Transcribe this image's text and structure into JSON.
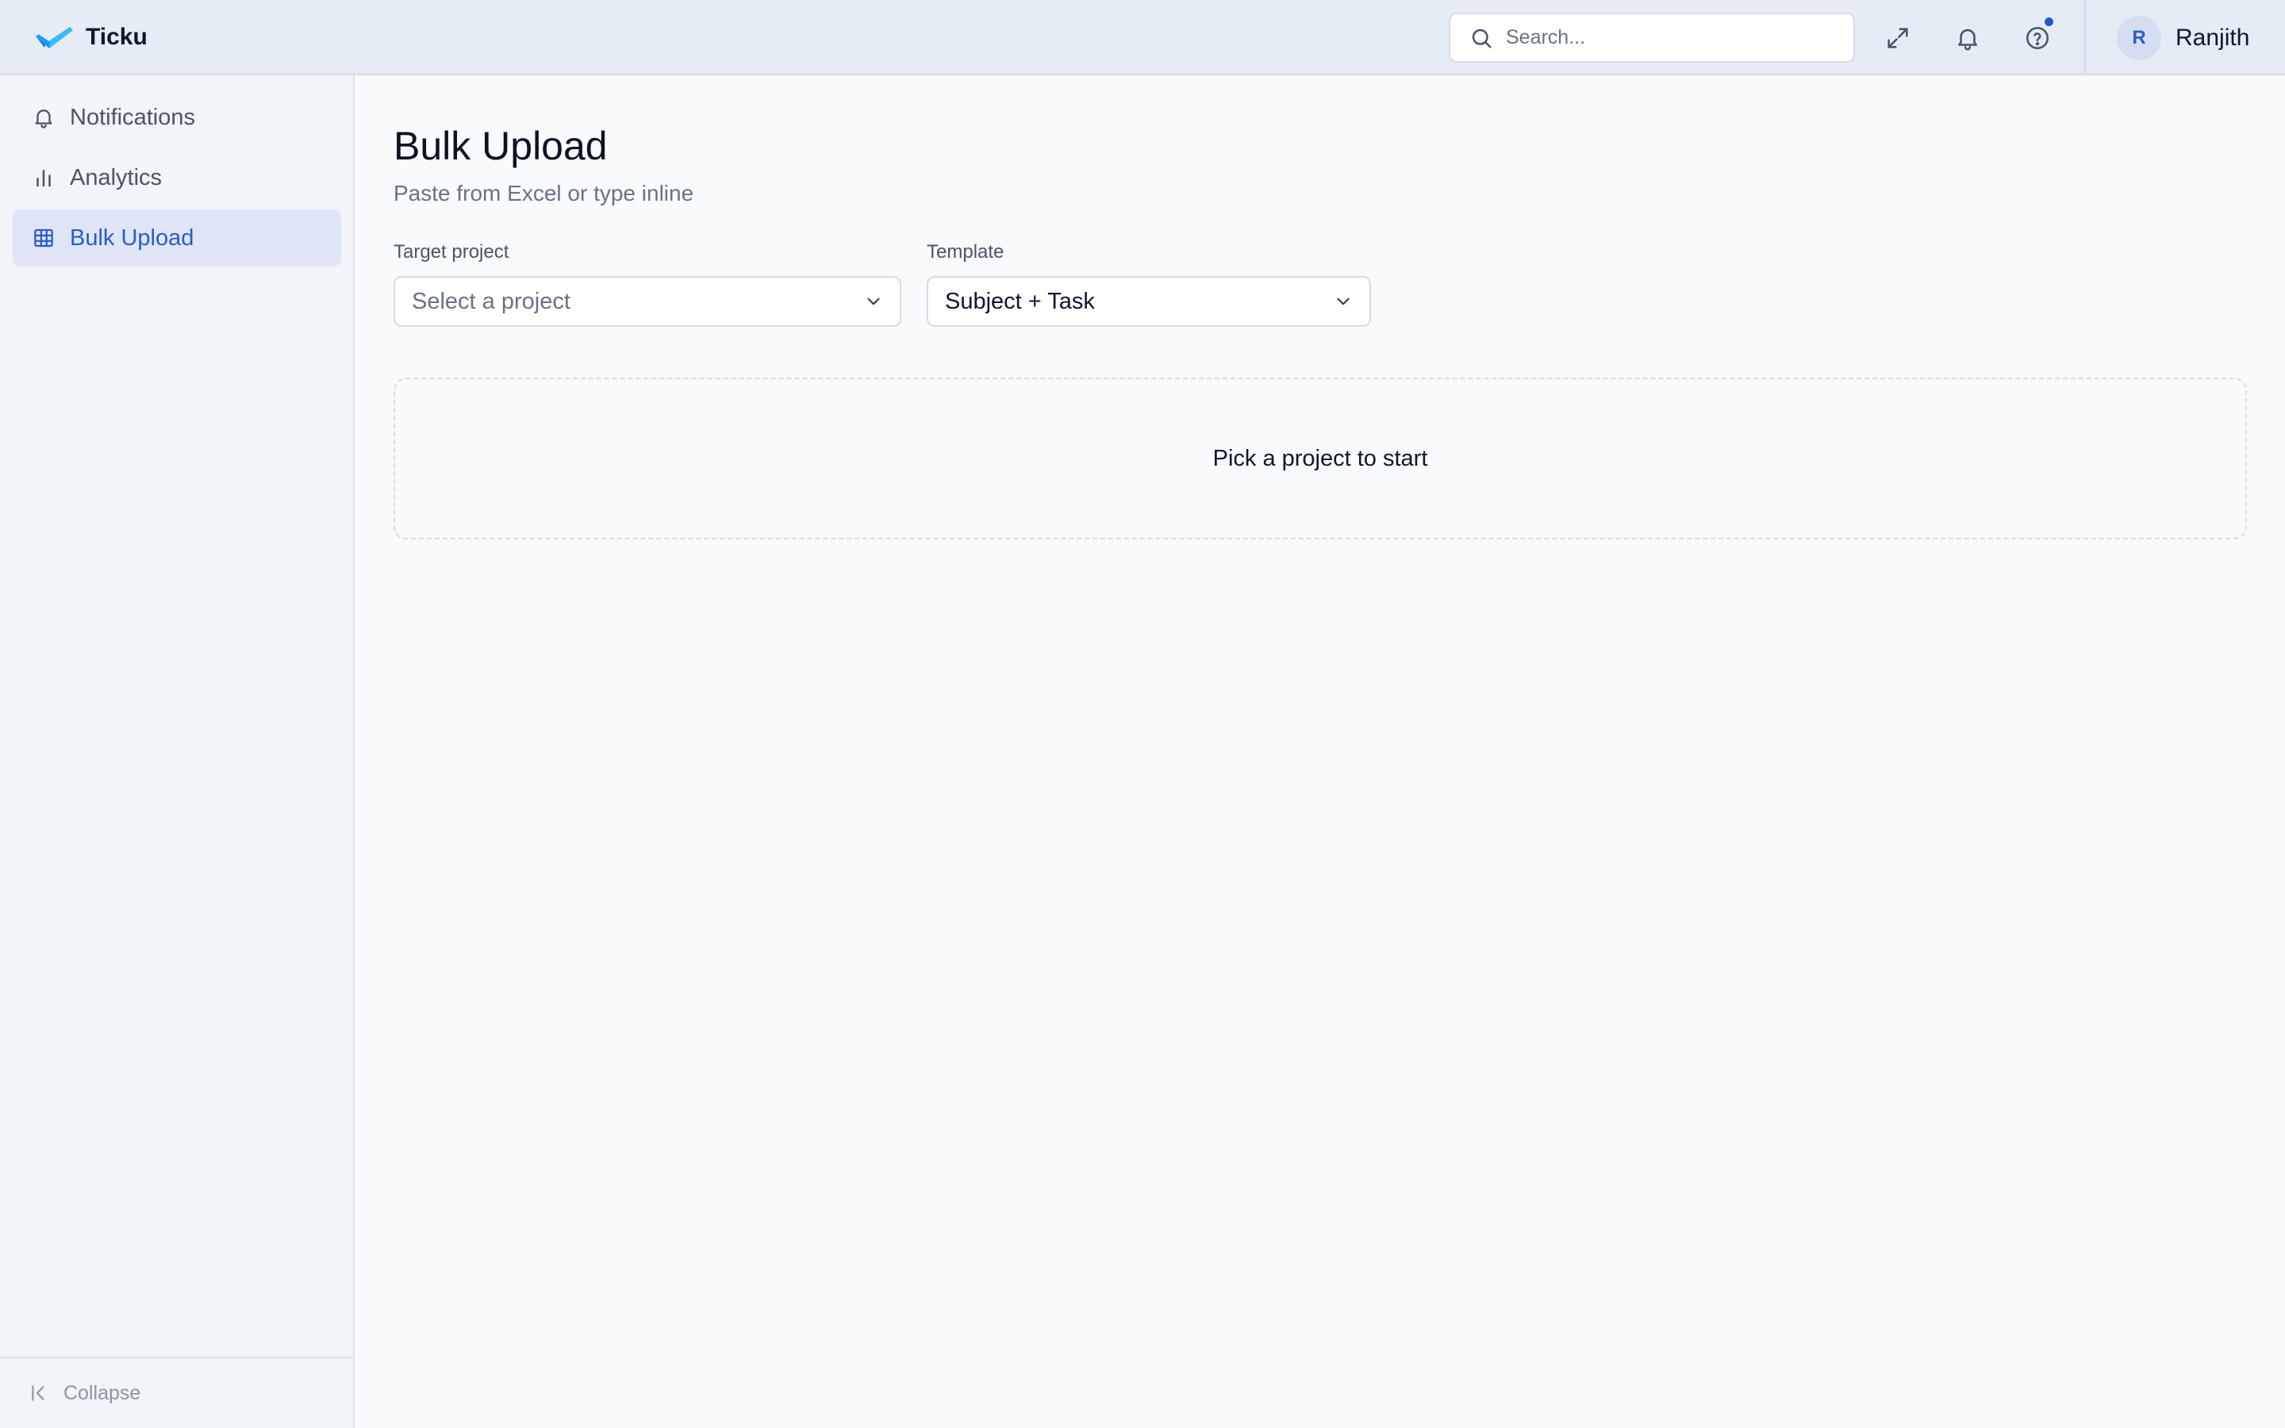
{
  "app": {
    "name": "Ticku",
    "accent_color": "#2e5ac4"
  },
  "header": {
    "search_placeholder": "Search...",
    "icons": [
      "expand-icon",
      "bell-icon",
      "help-icon"
    ],
    "help_has_notification_dot": true,
    "user": {
      "initial": "R",
      "name": "Ranjith"
    }
  },
  "sidebar": {
    "items": [
      {
        "label": "Notifications",
        "icon": "bell-icon",
        "active": false
      },
      {
        "label": "Analytics",
        "icon": "bar-chart-icon",
        "active": false
      },
      {
        "label": "Bulk Upload",
        "icon": "table-icon",
        "active": true
      }
    ],
    "collapse_label": "Collapse"
  },
  "main": {
    "title": "Bulk Upload",
    "subtitle": "Paste from Excel or type inline",
    "target_project": {
      "label": "Target project",
      "placeholder": "Select a project",
      "value": ""
    },
    "template": {
      "label": "Template",
      "value": "Subject + Task"
    },
    "empty_state": "Pick a project to start"
  }
}
